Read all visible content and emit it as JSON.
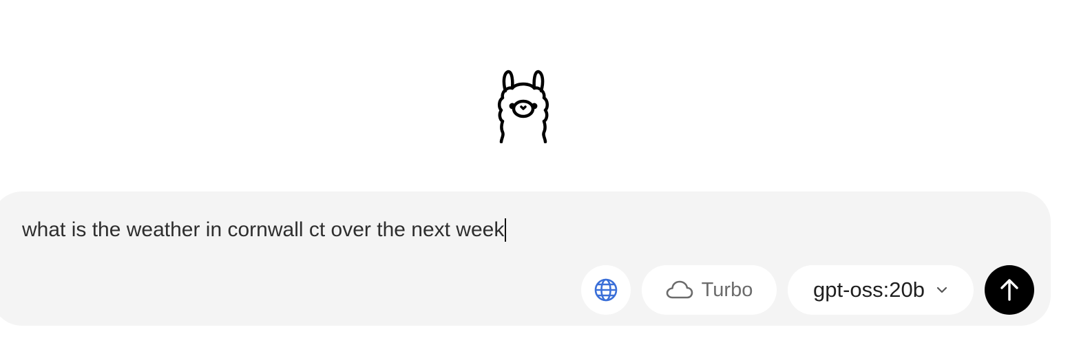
{
  "logo": {
    "name": "llama-logo"
  },
  "composer": {
    "input_value": "what is the weather in cornwall ct over the next week",
    "web_search_icon": "globe-icon",
    "web_search_color": "#3a6fd8",
    "turbo": {
      "icon": "cloud-icon",
      "label": "Turbo"
    },
    "model": {
      "value": "gpt-oss:20b",
      "icon": "chevron-down-icon"
    },
    "send": {
      "icon": "arrow-up-icon",
      "color": "#000000"
    }
  }
}
